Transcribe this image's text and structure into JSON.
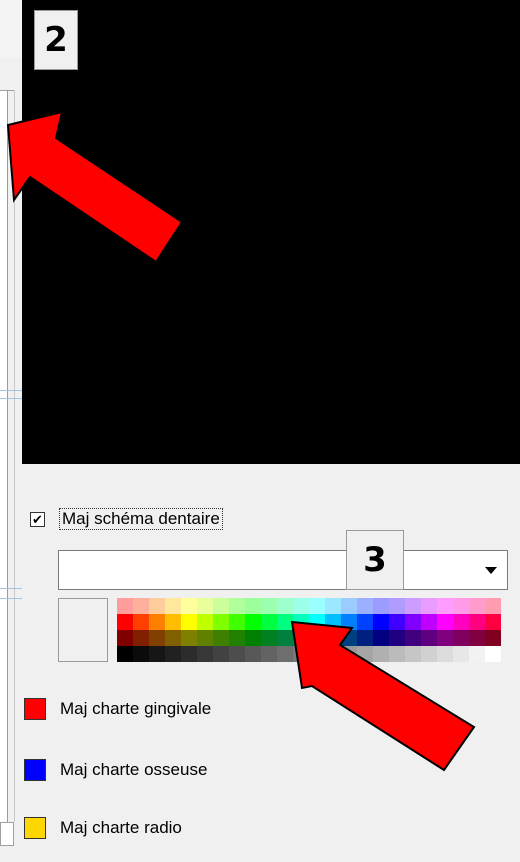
{
  "labels": {
    "step2": "2",
    "step3": "3"
  },
  "checkbox": {
    "checked_mark": "✔",
    "label": "Maj schéma dentaire"
  },
  "dropdown": {
    "value": ""
  },
  "legend": [
    {
      "label": "Maj charte gingivale",
      "color": "#ff0000"
    },
    {
      "label": "Maj charte osseuse",
      "color": "#0000ff"
    },
    {
      "label": "Maj charte radio",
      "color": "#ffd700"
    }
  ],
  "palette_rows": [
    [
      "#ff9c9c",
      "#ffb09c",
      "#ffcc9c",
      "#ffe89c",
      "#ffff9c",
      "#e8ff9c",
      "#ccff9c",
      "#b0ff9c",
      "#9cff9c",
      "#9cffb0",
      "#9cffcc",
      "#9cffe8",
      "#9cffff",
      "#9ce8ff",
      "#9cccff",
      "#9cb0ff",
      "#9c9cff",
      "#b09cff",
      "#cc9cff",
      "#e89cff",
      "#ff9cff",
      "#ff9ce8",
      "#ff9ccc",
      "#ff9cb0"
    ],
    [
      "#ff0000",
      "#ff4000",
      "#ff8000",
      "#ffbf00",
      "#ffff00",
      "#bfff00",
      "#80ff00",
      "#40ff00",
      "#00ff00",
      "#00ff40",
      "#00ff80",
      "#00ffbf",
      "#00ffff",
      "#00bfff",
      "#0080ff",
      "#0040ff",
      "#0000ff",
      "#4000ff",
      "#8000ff",
      "#bf00ff",
      "#ff00ff",
      "#ff00bf",
      "#ff0080",
      "#ff0040"
    ],
    [
      "#800000",
      "#802000",
      "#804000",
      "#806000",
      "#808000",
      "#608000",
      "#408000",
      "#208000",
      "#008000",
      "#008020",
      "#008040",
      "#008060",
      "#008080",
      "#006080",
      "#004080",
      "#002080",
      "#000080",
      "#200080",
      "#400080",
      "#600080",
      "#800080",
      "#800060",
      "#800040",
      "#800020"
    ],
    [
      "#000000",
      "#0b0b0b",
      "#161616",
      "#212121",
      "#2c2c2c",
      "#373737",
      "#424242",
      "#4d4d4d",
      "#585858",
      "#636363",
      "#6e6e6e",
      "#797979",
      "#848484",
      "#8f8f8f",
      "#9a9a9a",
      "#a5a5a5",
      "#b0b0b0",
      "#bbbbbb",
      "#c6c6c6",
      "#d1d1d1",
      "#dcdcdc",
      "#e7e7e7",
      "#f2f2f2",
      "#ffffff"
    ]
  ],
  "colors": {
    "arrow": "#ff0000",
    "arrow_outline": "#000000"
  }
}
